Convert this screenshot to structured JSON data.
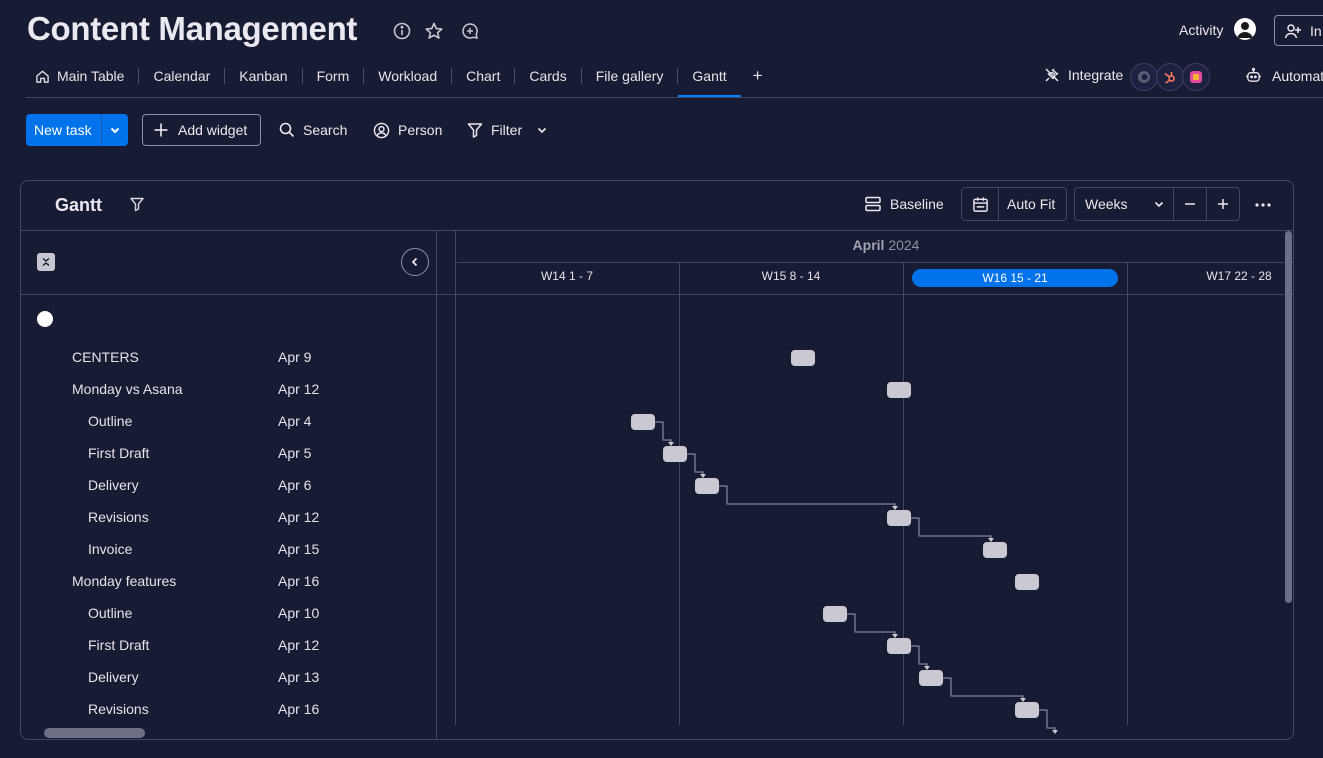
{
  "header": {
    "title": "Content Management",
    "icons": [
      "info-icon",
      "star-icon",
      "chat-plus-icon"
    ],
    "activity_label": "Activity",
    "invite_label": "In"
  },
  "tabs": [
    {
      "label": "Main Table",
      "icon": "home-icon"
    },
    {
      "label": "Calendar"
    },
    {
      "label": "Kanban"
    },
    {
      "label": "Form"
    },
    {
      "label": "Workload"
    },
    {
      "label": "Chart"
    },
    {
      "label": "Cards"
    },
    {
      "label": "File gallery"
    },
    {
      "label": "Gantt",
      "active": true
    },
    {
      "label": "+"
    }
  ],
  "integrate": {
    "label": "Integrate"
  },
  "automate": {
    "label": "Automat"
  },
  "toolbar": {
    "new_task": "New task",
    "add_widget": "Add widget",
    "search": "Search",
    "person": "Person",
    "filter": "Filter"
  },
  "gantt": {
    "title": "Gantt",
    "baseline": "Baseline",
    "auto_fit": "Auto Fit",
    "zoom": "Weeks",
    "month": "April",
    "year": "2024",
    "weeks": [
      {
        "label": "W14 1 - 7"
      },
      {
        "label": "W15 8 - 14"
      },
      {
        "label": "W16 15 - 21",
        "current": true
      },
      {
        "label": "W17 22 - 28"
      }
    ],
    "rows": [
      {
        "name": "CENTERS",
        "date": "Apr 9",
        "level": 0,
        "day": 9
      },
      {
        "name": "Monday vs Asana",
        "date": "Apr 12",
        "level": 0,
        "day": 12
      },
      {
        "name": "Outline",
        "date": "Apr 4",
        "level": 1,
        "day": 4
      },
      {
        "name": "First Draft",
        "date": "Apr 5",
        "level": 1,
        "day": 5
      },
      {
        "name": "Delivery",
        "date": "Apr 6",
        "level": 1,
        "day": 6
      },
      {
        "name": "Revisions",
        "date": "Apr 12",
        "level": 1,
        "day": 12
      },
      {
        "name": "Invoice",
        "date": "Apr 15",
        "level": 1,
        "day": 15
      },
      {
        "name": "Monday features",
        "date": "Apr 16",
        "level": 0,
        "day": 16
      },
      {
        "name": "Outline",
        "date": "Apr 10",
        "level": 1,
        "day": 10
      },
      {
        "name": "First Draft",
        "date": "Apr 12",
        "level": 1,
        "day": 12
      },
      {
        "name": "Delivery",
        "date": "Apr 13",
        "level": 1,
        "day": 13
      },
      {
        "name": "Revisions",
        "date": "Apr 16",
        "level": 1,
        "day": 16
      }
    ],
    "dependencies": [
      [
        2,
        3
      ],
      [
        3,
        4
      ],
      [
        4,
        5
      ],
      [
        5,
        6
      ],
      [
        8,
        9
      ],
      [
        9,
        10
      ],
      [
        10,
        11
      ],
      [
        11,
        12
      ]
    ]
  }
}
